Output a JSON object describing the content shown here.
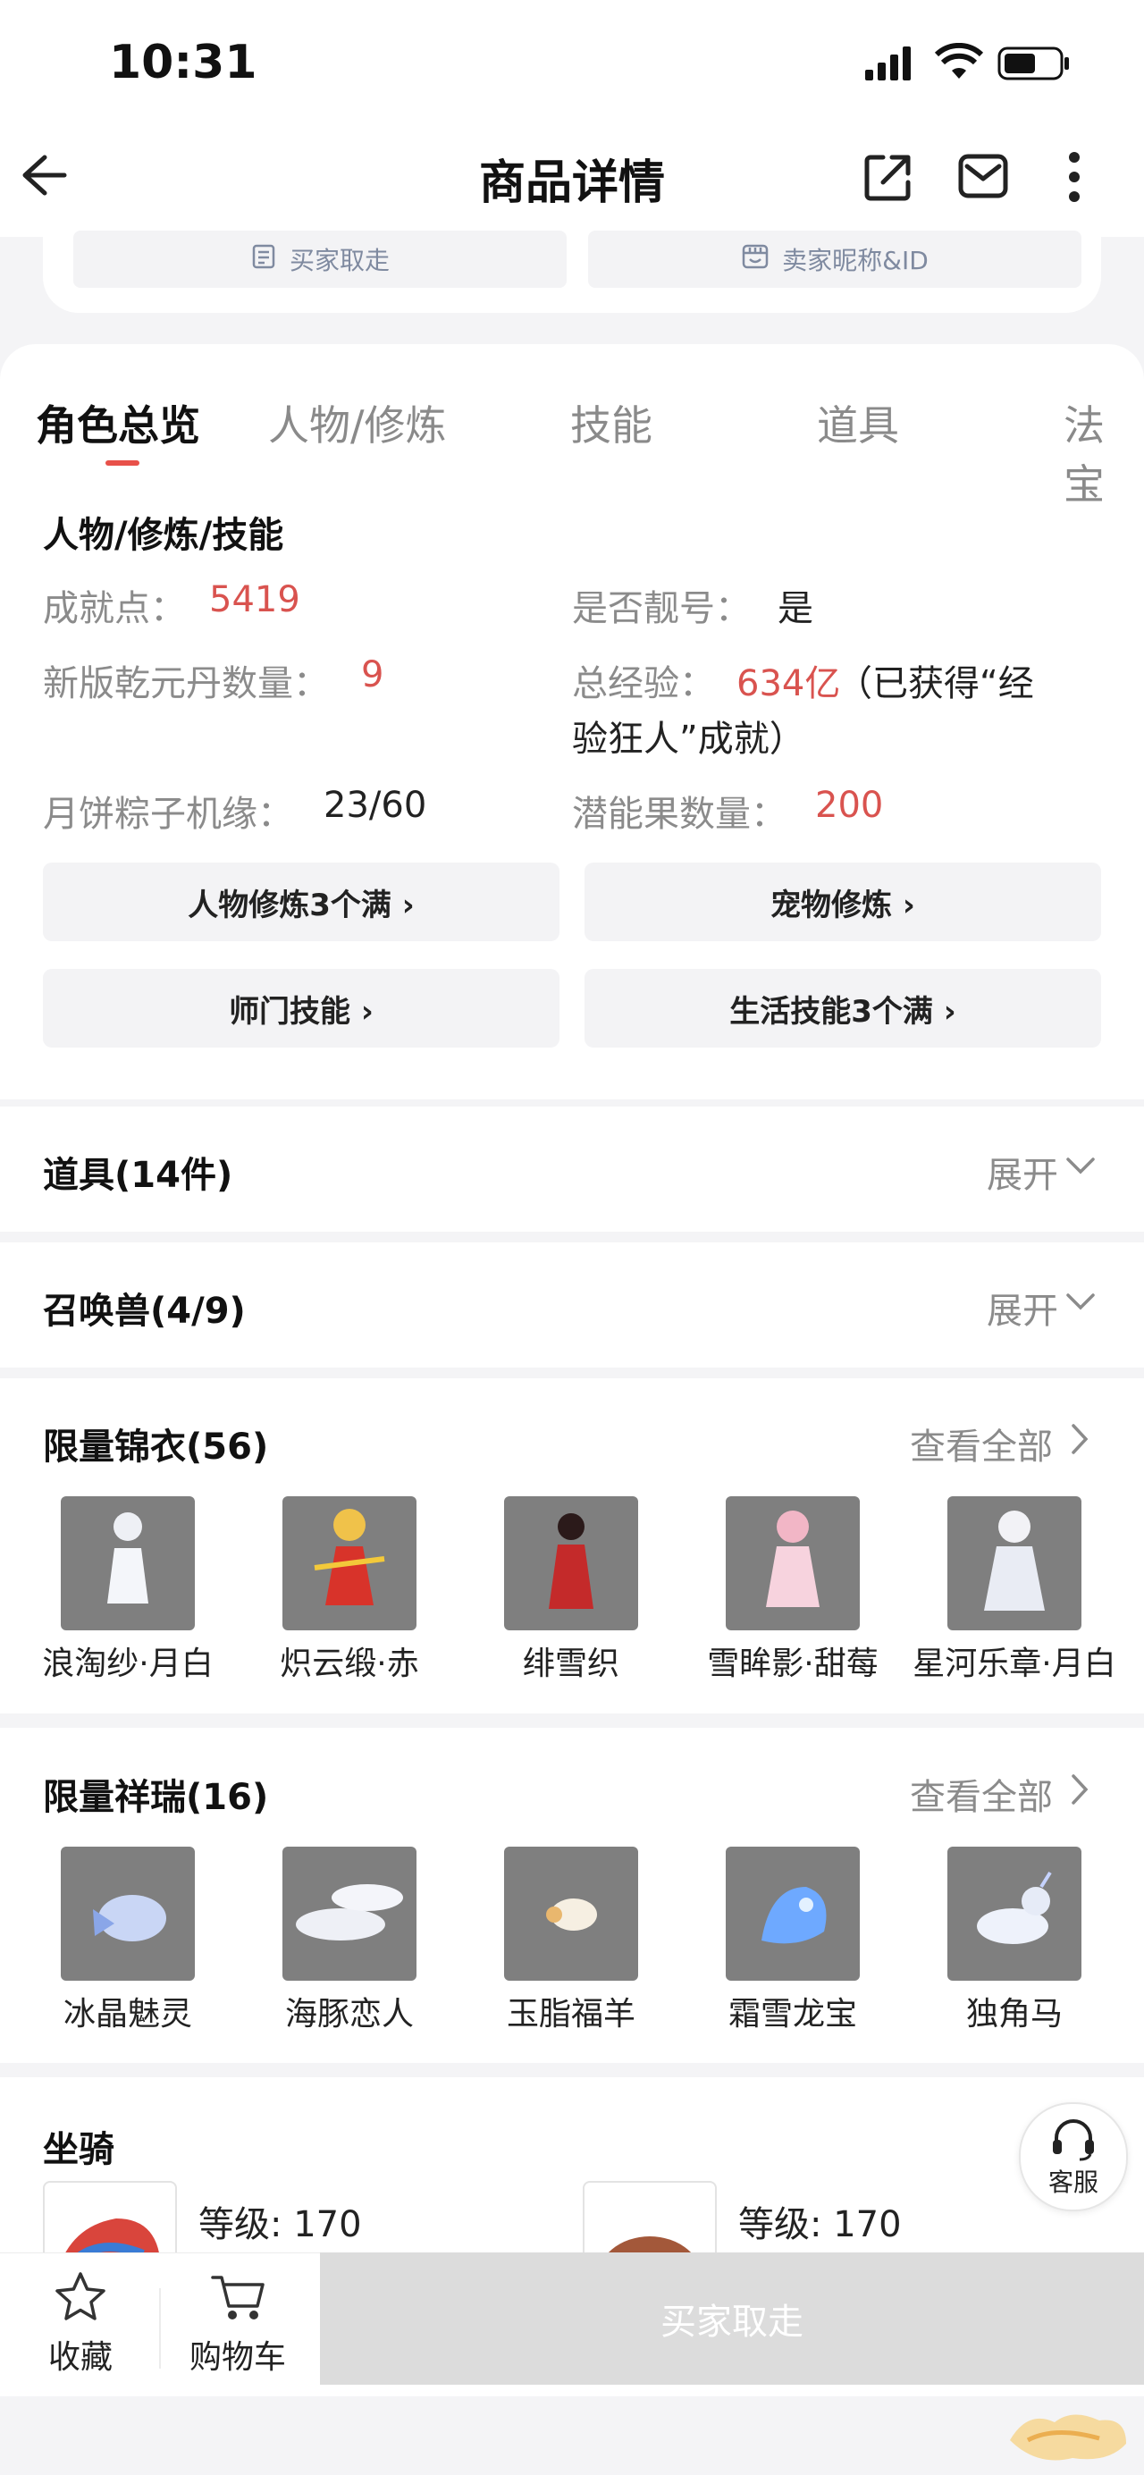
{
  "status": {
    "time": "10:31"
  },
  "nav": {
    "title": "商品详情"
  },
  "top_buttons": [
    {
      "label": "买家取走",
      "icon": "list-doc-icon"
    },
    {
      "label": "卖家昵称&ID",
      "icon": "store-icon"
    }
  ],
  "tabs": [
    "角色总览",
    "人物/修炼",
    "技能",
    "道具",
    "法宝"
  ],
  "overview": {
    "title": "人物/修炼/技能",
    "achievement": {
      "label": "成就点：",
      "value": "5419"
    },
    "is_pretty": {
      "label": "是否靓号：",
      "value": "是"
    },
    "qianyuan": {
      "label": "新版乾元丹数量：",
      "value": "9"
    },
    "total_exp": {
      "label": "总经验：",
      "value": "634亿",
      "note": "（已获得“经",
      "note2": "验狂人”成就）"
    },
    "mooncake": {
      "label": "月饼粽子机缘：",
      "value": "23/60"
    },
    "potential": {
      "label": "潜能果数量：",
      "value": "200"
    },
    "buttons": [
      "人物修炼3个满 ›",
      "宠物修炼 ›",
      "师门技能 ›",
      "生活技能3个满 ›"
    ]
  },
  "items_row": {
    "title": "道具(14件)",
    "action": "展开"
  },
  "pets_row": {
    "title": "召唤兽(4/9)",
    "action": "展开"
  },
  "outfits": {
    "title": "限量锦衣(56)",
    "action": "查看全部",
    "items": [
      "浪淘纱·月白",
      "炽云缎·赤",
      "绯雪织",
      "雪眸影·甜莓",
      "星河乐章·月白"
    ]
  },
  "auspicious": {
    "title": "限量祥瑞(16)",
    "action": "查看全部",
    "items": [
      "冰晶魅灵",
      "海豚恋人",
      "玉脂福羊",
      "霜雪龙宝",
      "独角马"
    ]
  },
  "mounts": {
    "title": "坐骑",
    "items": [
      {
        "level": "等级: 170"
      },
      {
        "level": "等级: 170"
      }
    ]
  },
  "service": {
    "label": "客服"
  },
  "bottom": {
    "favorite": "收藏",
    "cart": "购物车",
    "buy": "买家取走"
  },
  "colors": {
    "accent": "#e8514a",
    "value_red": "#d9534f",
    "thumb_bg": "#7f7f7f"
  }
}
